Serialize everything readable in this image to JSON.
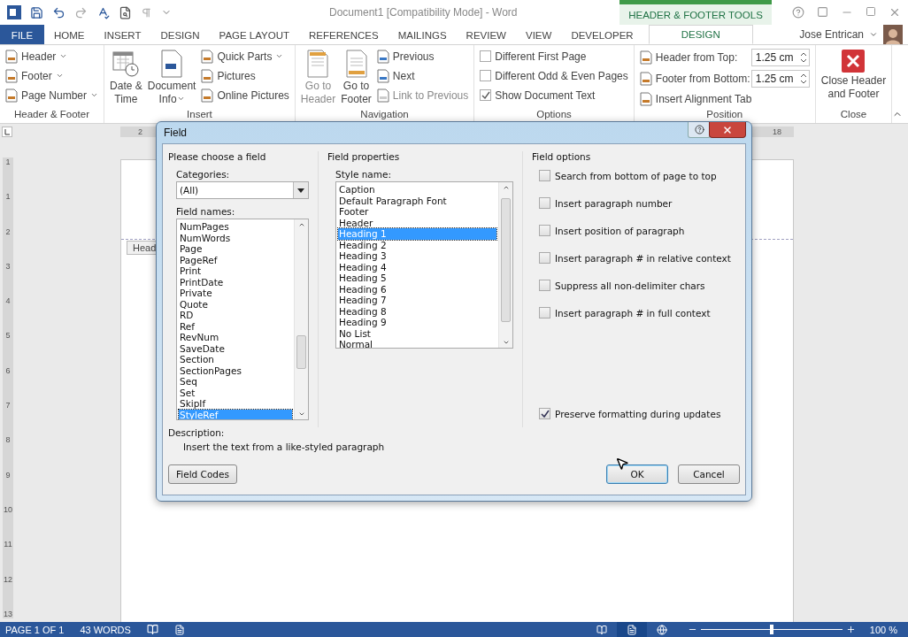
{
  "title_bar": {
    "title": "Document1 [Compatibility Mode] - Word",
    "contextual_label": "HEADER & FOOTER TOOLS"
  },
  "tabs": [
    {
      "label": "FILE",
      "kind": "file",
      "selected": false
    },
    {
      "label": "HOME",
      "kind": "normal",
      "selected": false
    },
    {
      "label": "INSERT",
      "kind": "normal",
      "selected": false
    },
    {
      "label": "DESIGN",
      "kind": "normal",
      "selected": false
    },
    {
      "label": "PAGE LAYOUT",
      "kind": "normal",
      "selected": false
    },
    {
      "label": "REFERENCES",
      "kind": "normal",
      "selected": false
    },
    {
      "label": "MAILINGS",
      "kind": "normal",
      "selected": false
    },
    {
      "label": "REVIEW",
      "kind": "normal",
      "selected": false
    },
    {
      "label": "VIEW",
      "kind": "normal",
      "selected": false
    },
    {
      "label": "DEVELOPER",
      "kind": "normal",
      "selected": false
    },
    {
      "label": "DESIGN",
      "kind": "contextual",
      "selected": true
    }
  ],
  "user": {
    "name": "Jose Entrican"
  },
  "ribbon_groups": [
    {
      "label": "Header & Footer",
      "columns": [
        [
          {
            "kind": "small",
            "label": "Header",
            "dropdown": true,
            "disabled": false
          },
          {
            "kind": "small",
            "label": "Footer",
            "dropdown": true,
            "disabled": false
          },
          {
            "kind": "small",
            "label": "Page Number",
            "dropdown": true,
            "disabled": false
          }
        ]
      ]
    },
    {
      "label": "Insert",
      "columns": [
        [
          {
            "kind": "large",
            "lines": [
              "Date &",
              "Time"
            ],
            "dropdown": false,
            "disabled": false
          }
        ],
        [
          {
            "kind": "large",
            "lines": [
              "Document",
              "Info"
            ],
            "dropdown": true,
            "disabled": false
          }
        ],
        [
          {
            "kind": "small",
            "label": "Quick Parts",
            "dropdown": true,
            "disabled": false
          },
          {
            "kind": "small",
            "label": "Pictures",
            "dropdown": false,
            "disabled": false
          },
          {
            "kind": "small",
            "label": "Online Pictures",
            "dropdown": false,
            "disabled": false
          }
        ]
      ]
    },
    {
      "label": "Navigation",
      "columns": [
        [
          {
            "kind": "large",
            "lines": [
              "Go to",
              "Header"
            ],
            "dropdown": false,
            "disabled": true
          }
        ],
        [
          {
            "kind": "large",
            "lines": [
              "Go to",
              "Footer"
            ],
            "dropdown": false,
            "disabled": false
          }
        ],
        [
          {
            "kind": "small",
            "label": "Previous",
            "dropdown": false,
            "disabled": false
          },
          {
            "kind": "small",
            "label": "Next",
            "dropdown": false,
            "disabled": false
          },
          {
            "kind": "small",
            "label": "Link to Previous",
            "dropdown": false,
            "disabled": true
          }
        ]
      ]
    },
    {
      "label": "Options",
      "columns": [
        [
          {
            "kind": "checkbox",
            "label": "Different First Page",
            "checked": false
          },
          {
            "kind": "checkbox",
            "label": "Different Odd & Even Pages",
            "checked": false
          },
          {
            "kind": "checkbox",
            "label": "Show Document Text",
            "checked": true
          }
        ]
      ]
    },
    {
      "label": "Position",
      "columns": [
        [
          {
            "kind": "spin",
            "label": "Header from Top:",
            "value": "1.25 cm"
          },
          {
            "kind": "spin",
            "label": "Footer from Bottom:",
            "value": "1.25 cm"
          },
          {
            "kind": "small",
            "label": "Insert Alignment Tab",
            "dropdown": false,
            "disabled": false
          }
        ]
      ]
    },
    {
      "label": "Close",
      "columns": [
        [
          {
            "kind": "large",
            "lines": [
              "Close Header",
              "and Footer"
            ],
            "dropdown": false,
            "disabled": false
          }
        ]
      ]
    }
  ],
  "ruler": {
    "horizontal_labels": [
      "2",
      "18"
    ],
    "vertical_labels": [
      "1",
      "1",
      "2",
      "3",
      "4",
      "5",
      "6",
      "7",
      "8",
      "9",
      "10",
      "11",
      "12",
      "13"
    ]
  },
  "document": {
    "header_tag": "Head"
  },
  "dialog": {
    "title": "Field",
    "choose_heading": "Please choose a field",
    "categories_label": "Categories:",
    "category_value": "(All)",
    "field_names_label": "Field names:",
    "field_names": [
      {
        "label": "NumPages",
        "selected": false
      },
      {
        "label": "NumWords",
        "selected": false
      },
      {
        "label": "Page",
        "selected": false
      },
      {
        "label": "PageRef",
        "selected": false
      },
      {
        "label": "Print",
        "selected": false
      },
      {
        "label": "PrintDate",
        "selected": false
      },
      {
        "label": "Private",
        "selected": false
      },
      {
        "label": "Quote",
        "selected": false
      },
      {
        "label": "RD",
        "selected": false
      },
      {
        "label": "Ref",
        "selected": false
      },
      {
        "label": "RevNum",
        "selected": false
      },
      {
        "label": "SaveDate",
        "selected": false
      },
      {
        "label": "Section",
        "selected": false
      },
      {
        "label": "SectionPages",
        "selected": false
      },
      {
        "label": "Seq",
        "selected": false
      },
      {
        "label": "Set",
        "selected": false
      },
      {
        "label": "SkipIf",
        "selected": false
      },
      {
        "label": "StyleRef",
        "selected": true
      }
    ],
    "properties_heading": "Field properties",
    "style_name_label": "Style name:",
    "styles": [
      {
        "label": "Caption",
        "selected": false
      },
      {
        "label": "Default Paragraph Font",
        "selected": false
      },
      {
        "label": "Footer",
        "selected": false
      },
      {
        "label": "Header",
        "selected": false
      },
      {
        "label": "Heading 1",
        "selected": true
      },
      {
        "label": "Heading 2",
        "selected": false
      },
      {
        "label": "Heading 3",
        "selected": false
      },
      {
        "label": "Heading 4",
        "selected": false
      },
      {
        "label": "Heading 5",
        "selected": false
      },
      {
        "label": "Heading 6",
        "selected": false
      },
      {
        "label": "Heading 7",
        "selected": false
      },
      {
        "label": "Heading 8",
        "selected": false
      },
      {
        "label": "Heading 9",
        "selected": false
      },
      {
        "label": "No List",
        "selected": false
      },
      {
        "label": "Normal",
        "selected": false
      }
    ],
    "options_heading": "Field options",
    "options": [
      {
        "label": "Search from bottom of page to top",
        "checked": false
      },
      {
        "label": "Insert paragraph number",
        "checked": false
      },
      {
        "label": "Insert position of paragraph",
        "checked": false
      },
      {
        "label": "Insert paragraph # in relative context",
        "checked": false
      },
      {
        "label": "Suppress all non-delimiter chars",
        "checked": false
      },
      {
        "label": "Insert paragraph # in full context",
        "checked": false
      }
    ],
    "preserve": {
      "label": "Preserve formatting during updates",
      "checked": true
    },
    "description_label": "Description:",
    "description": "Insert the text from a like-styled paragraph",
    "buttons": [
      {
        "label": "Field Codes",
        "kind": "normal"
      },
      {
        "label": "OK",
        "kind": "default"
      },
      {
        "label": "Cancel",
        "kind": "normal"
      }
    ]
  },
  "status_bar": {
    "page": "PAGE 1 OF 1",
    "words": "43 WORDS",
    "views": [
      {
        "selected": false
      },
      {
        "selected": true
      },
      {
        "selected": false
      }
    ],
    "zoom": {
      "level": 0.5,
      "percent": "100 %"
    }
  }
}
